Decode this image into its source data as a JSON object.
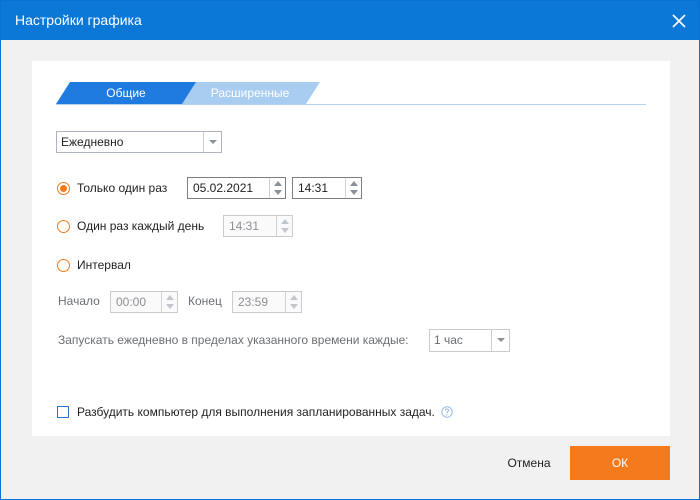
{
  "window": {
    "title": "Настройки графика"
  },
  "tabs": [
    {
      "label": "Общие",
      "active": true
    },
    {
      "label": "Расширенные",
      "active": false
    }
  ],
  "frequency": {
    "selected": "Ежедневно"
  },
  "options": {
    "once": {
      "label": "Только один раз",
      "checked": true,
      "date": "05.02.2021",
      "time": "14:31"
    },
    "daily": {
      "label": "Один раз каждый день",
      "checked": false,
      "time": "14:31"
    },
    "interval": {
      "label": "Интервал",
      "checked": false
    }
  },
  "interval_settings": {
    "start_label": "Начало",
    "start_value": "00:00",
    "end_label": "Конец",
    "end_value": "23:59",
    "repeat_label": "Запускать ежедневно в пределах указанного времени каждые:",
    "repeat_value": "1 час"
  },
  "wake": {
    "label": "Разбудить компьютер для выполнения запланированных задач.",
    "checked": false
  },
  "buttons": {
    "cancel": "Отмена",
    "ok": "ОК"
  },
  "colors": {
    "titlebar": "#0b78d8",
    "accent": "#f57a1c",
    "tab_active": "#1f7be0",
    "tab_inactive": "#a9cdf1"
  }
}
